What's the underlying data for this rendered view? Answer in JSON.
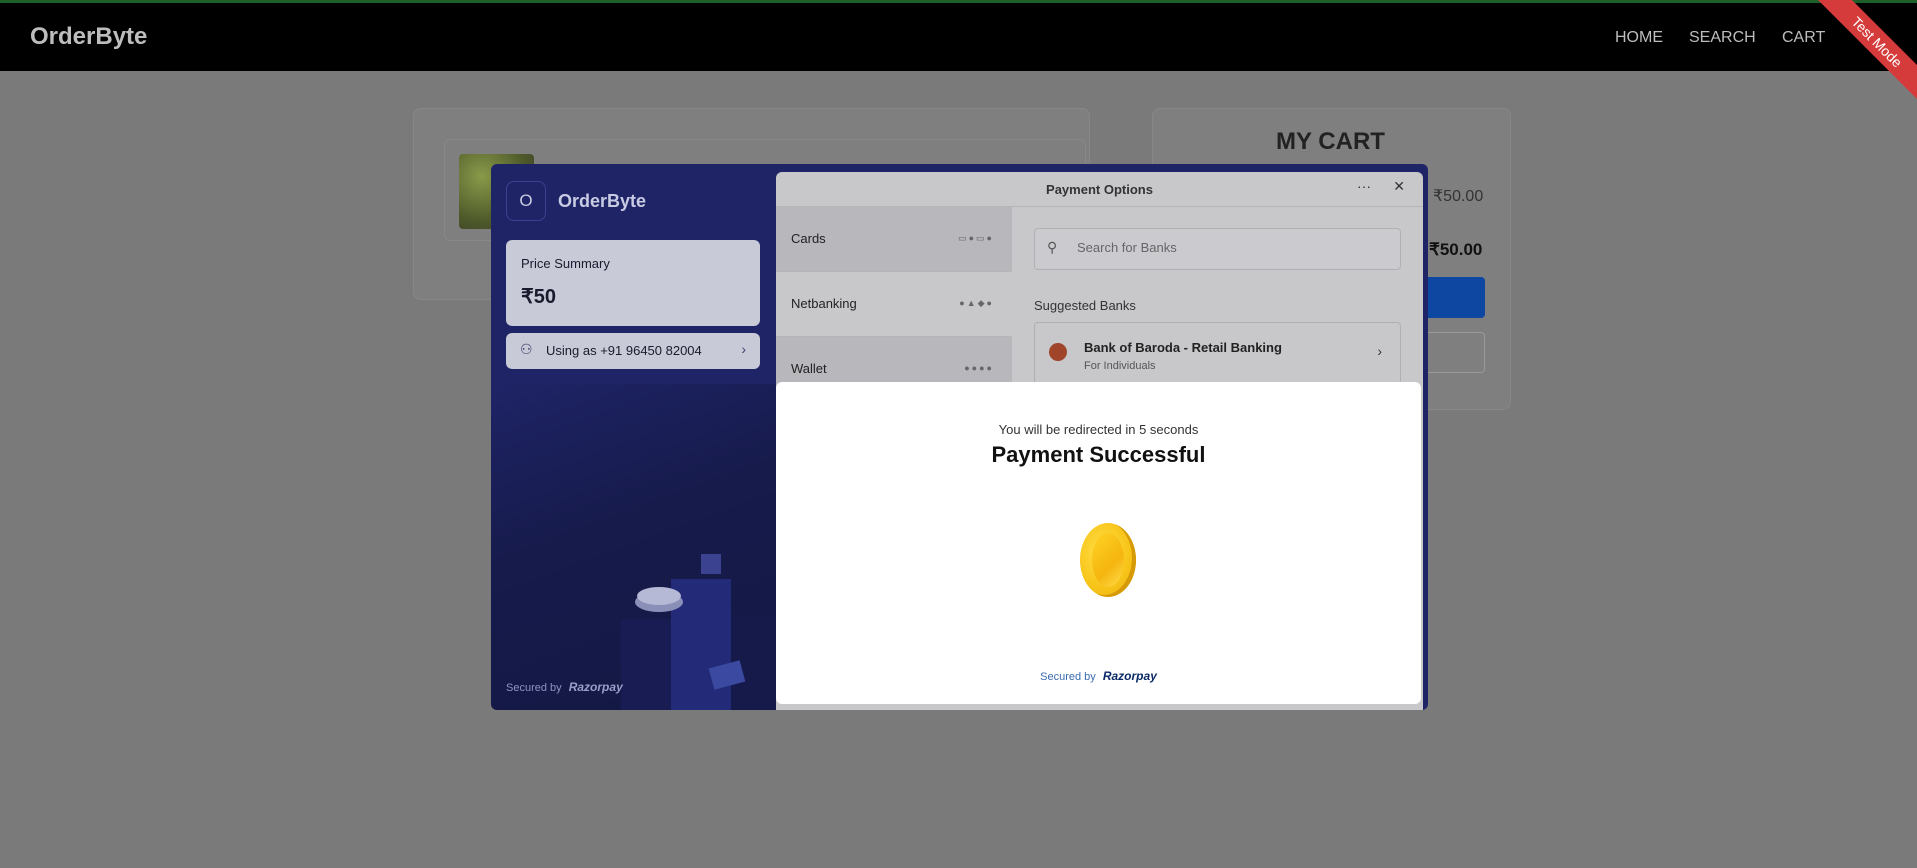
{
  "navbar": {
    "brand": "OrderByte",
    "links": [
      "HOME",
      "SEARCH",
      "CART"
    ],
    "ribbon": "Test Mode"
  },
  "cart": {
    "title": "MY CART",
    "subtotal": "₹50.00",
    "total": "₹50.00"
  },
  "checkout": {
    "merchant_initial": "O",
    "merchant_name": "OrderByte",
    "price_summary_label": "Price Summary",
    "price_summary_value": "₹50",
    "using_as": "Using as +91 96450 82004",
    "secured_by": "Secured by",
    "razorpay": "Razorpay",
    "panel_title": "Payment Options",
    "methods": [
      "Cards",
      "Netbanking",
      "Wallet"
    ],
    "search_placeholder": "Search for Banks",
    "suggested_label": "Suggested Banks",
    "bank": {
      "name": "Bank of Baroda - Retail Banking",
      "sub": "For Individuals"
    }
  },
  "success": {
    "redirect_text": "You will be redirected in 5 seconds",
    "title": "Payment Successful",
    "secured_by": "Secured by",
    "razorpay": "Razorpay"
  },
  "colors": {
    "navbar": "#000000",
    "ribbon": "#d63b3b",
    "modal_bg": "#1e2466",
    "coin": "#f8c51a"
  }
}
